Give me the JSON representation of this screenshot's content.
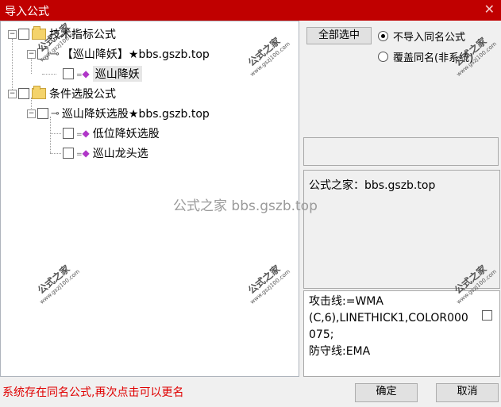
{
  "window": {
    "title": "导入公式",
    "close_glyph": "✕"
  },
  "tree": {
    "nodes": [
      {
        "label": "技术指标公式",
        "expander": "−",
        "kind": "folder"
      },
      {
        "label": "【巡山降妖】★bbs.gszb.top",
        "expander": "−",
        "kind": "key"
      },
      {
        "label": "巡山降妖",
        "kind": "formula",
        "selected": true
      },
      {
        "label": "条件选股公式",
        "expander": "−",
        "kind": "folder"
      },
      {
        "label": "巡山降妖选股★bbs.gszb.top",
        "expander": "−",
        "kind": "key"
      },
      {
        "label": "低位降妖选股",
        "kind": "formula"
      },
      {
        "label": "巡山龙头选",
        "kind": "formula"
      }
    ]
  },
  "options": {
    "select_all_label": "全部选中",
    "radio_no_import": "不导入同名公式",
    "radio_overwrite": "覆盖同名(非系统)",
    "selected_radio": "no_import"
  },
  "info": {
    "text": "公式之家：bbs.gszb.top"
  },
  "formula_lines": [
    "攻击线:=WMA",
    "(C,6),LINETHICK1,COLOR000",
    "075;",
    "防守线:EMA"
  ],
  "status_text": "系统存在同名公式,再次点击可以更名",
  "buttons": {
    "ok": "确定",
    "cancel": "取消"
  },
  "watermark": {
    "center": "公式之家 bbs.gszb.top",
    "stamp_title": "公式之家",
    "stamp_url": "www.gszj100.com"
  },
  "colors": {
    "titlebar": "#c00000",
    "status": "#e00000",
    "gem": "#b037c8"
  }
}
